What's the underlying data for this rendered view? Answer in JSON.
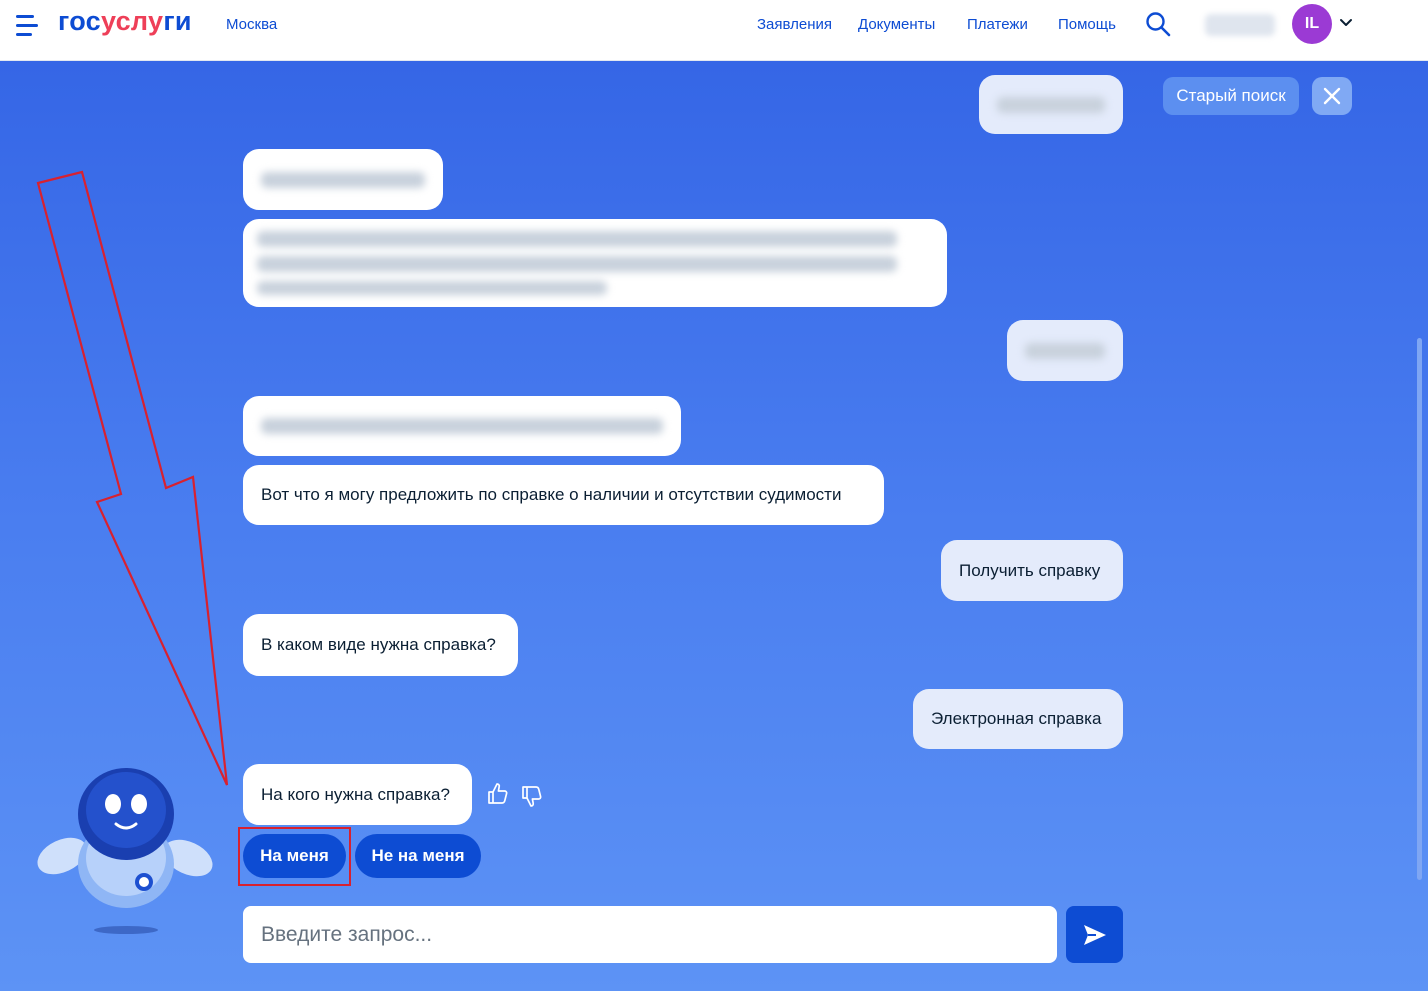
{
  "header": {
    "logo_part1": "гос",
    "logo_part2": "услу",
    "logo_part3": "ги",
    "city": "Москва",
    "nav": [
      "Заявления",
      "Документы",
      "Платежи",
      "Помощь"
    ],
    "avatar_initials": "IL"
  },
  "chat": {
    "old_search_label": "Старый поиск",
    "messages": [
      "Вот что я могу предложить по справке о наличии и отсутствии судимости",
      "Получить справку",
      "В каком виде нужна справка?",
      "Электронная справка",
      "На кого нужна справка?"
    ],
    "choices": [
      "На меня",
      "Не на меня"
    ],
    "input_placeholder": "Введите запрос..."
  },
  "colors": {
    "brand_blue": "#0d4cd3",
    "brand_red": "#ee3f58",
    "chat_gradient_top": "#3566e6",
    "chat_gradient_bottom": "#5d93f5",
    "annotation_red": "#d8212f",
    "avatar_purple": "#9b3ad4"
  },
  "icons": {
    "menu": "burger-menu-icon",
    "search": "search-icon",
    "close": "close-icon",
    "like": "thumbs-up-icon",
    "dislike": "thumbs-down-icon",
    "send": "send-arrow-icon",
    "chevron": "chevron-down-icon"
  }
}
